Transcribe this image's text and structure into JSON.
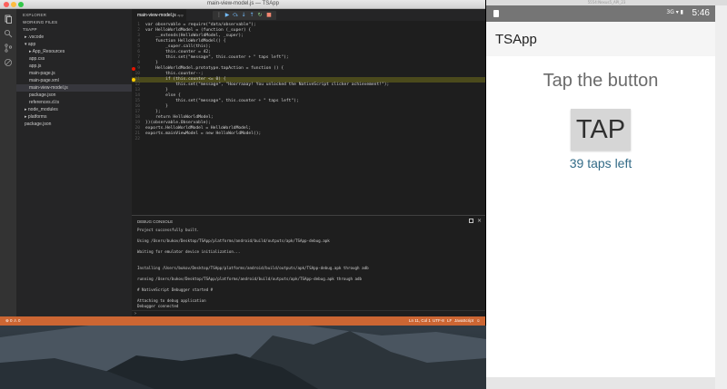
{
  "vscode": {
    "window_title": "main-view-model.js — TSApp",
    "sidebar": {
      "explorer_label": "EXPLORER",
      "working_files_label": "WORKING FILES",
      "project_label": "TSAPP",
      "items": [
        {
          "label": "▸ .vscode",
          "indent": 1
        },
        {
          "label": "▾ app",
          "indent": 1
        },
        {
          "label": "▸ App_Resources",
          "indent": 2
        },
        {
          "label": "app.css",
          "indent": 2
        },
        {
          "label": "app.js",
          "indent": 2
        },
        {
          "label": "main-page.js",
          "indent": 2
        },
        {
          "label": "main-page.xml",
          "indent": 2
        },
        {
          "label": "main-view-model.js",
          "indent": 2,
          "selected": true
        },
        {
          "label": "package.json",
          "indent": 2
        },
        {
          "label": "references.d.ts",
          "indent": 2
        },
        {
          "label": "▸ node_modules",
          "indent": 1
        },
        {
          "label": "▸ platforms",
          "indent": 1
        },
        {
          "label": "package.json",
          "indent": 1
        }
      ]
    },
    "tab": {
      "label": "main-view-model.js",
      "suffix": "app"
    },
    "code_lines": [
      {
        "n": "1",
        "text": "var observable = require(\"data/observable\");"
      },
      {
        "n": "2",
        "text": "var HelloWorldModel = (function (_super) {"
      },
      {
        "n": "3",
        "text": "    __extends(HelloWorldModel, _super);"
      },
      {
        "n": "4",
        "text": "    function HelloWorldModel() {"
      },
      {
        "n": "5",
        "text": "        _super.call(this);"
      },
      {
        "n": "6",
        "text": "        this.counter = 42;"
      },
      {
        "n": "7",
        "text": "        this.set(\"message\", this.counter + \" taps left\");"
      },
      {
        "n": "8",
        "text": "    }"
      },
      {
        "n": "9",
        "text": "    HelloWorldModel.prototype.tapAction = function () {",
        "bp": "red"
      },
      {
        "n": "10",
        "text": "        this.counter--;"
      },
      {
        "n": "11",
        "text": "        if (this.counter <= 0) {",
        "bp": "current",
        "hl": true
      },
      {
        "n": "12",
        "text": "            this.set(\"message\", \"Hoorraaay! You unlocked the NativeScript clicker achievement!\");"
      },
      {
        "n": "13",
        "text": "        }"
      },
      {
        "n": "14",
        "text": "        else {"
      },
      {
        "n": "15",
        "text": "            this.set(\"message\", this.counter + \" taps left\");"
      },
      {
        "n": "16",
        "text": "        }"
      },
      {
        "n": "17",
        "text": "    };"
      },
      {
        "n": "18",
        "text": "    return HelloWorldModel;"
      },
      {
        "n": "19",
        "text": "})(observable.Observable);"
      },
      {
        "n": "20",
        "text": "exports.HelloWorldModel = HelloWorldModel;"
      },
      {
        "n": "21",
        "text": "exports.mainViewModel = new HelloWorldModel();"
      },
      {
        "n": "22",
        "text": ""
      }
    ],
    "debug_console": {
      "title": "DEBUG CONSOLE",
      "lines": [
        "Project successfully built.",
        "",
        "Using  /Users/bukov/Desktop/TSApp/platforms/android/build/outputs/apk/TSApp-debug.apk",
        "",
        "Waiting for emulator device initialization...",
        "",
        "",
        "Installing /Users/bukov/Desktop/TSApp/platforms/android/build/outputs/apk/TSApp-debug.apk through adb",
        "",
        "running /Users/bukov/Desktop/TSApp/platforms/android/build/outputs/apk/TSApp-debug.apk through adb",
        "",
        "# NativeScript Debugger started #",
        "",
        "Attaching to debug application",
        "Debugger connected"
      ],
      "prompt": "›"
    },
    "statusbar": {
      "problems": "⊗ 0  ⚠ 0",
      "position": "Ln 11, Col 1",
      "encoding": "UTF-8",
      "eol": "LF",
      "language": "JavaScript",
      "smiley": "☺"
    },
    "colors": {
      "statusbar": "#cc6633",
      "editor_bg": "#1e1e1e",
      "sidebar_bg": "#252526"
    }
  },
  "emulator": {
    "window_title": "5554:Nexus5_API_23",
    "phone_status": {
      "signal": "3G ▾ ▮",
      "time": "5:46"
    },
    "app_title": "TSApp",
    "message": "Tap the button",
    "button_label": "TAP",
    "counter_text": "39 taps left"
  }
}
